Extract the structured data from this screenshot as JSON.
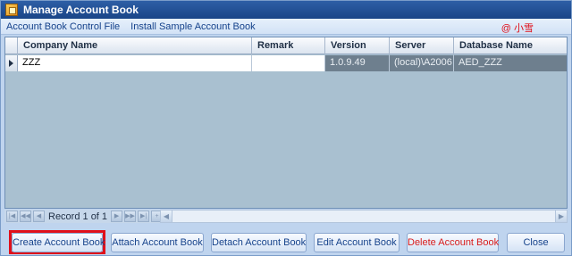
{
  "window": {
    "title": "Manage Account Book"
  },
  "menu": {
    "items": [
      "Account Book Control File",
      "Install Sample Account Book"
    ],
    "user_tag": "@ 小雪"
  },
  "grid": {
    "columns": [
      "Company Name",
      "Remark",
      "Version",
      "Server",
      "Database Name"
    ],
    "rows": [
      {
        "company_name": "ZZZ",
        "remark": "",
        "version": "1.0.9.49",
        "server": "(local)\\A2006",
        "database_name": "AED_ZZZ"
      }
    ]
  },
  "navigator": {
    "record_text": "Record 1 of 1"
  },
  "buttons": {
    "create": "Create Account Book",
    "attach": "Attach Account Book",
    "detach": "Detach Account Book",
    "edit": "Edit Account Book",
    "delete": "Delete Account Book",
    "close": "Close"
  },
  "colors": {
    "title_bar": "#1a4587",
    "highlight": "#e0101a",
    "delete_text": "#d81b1b"
  }
}
